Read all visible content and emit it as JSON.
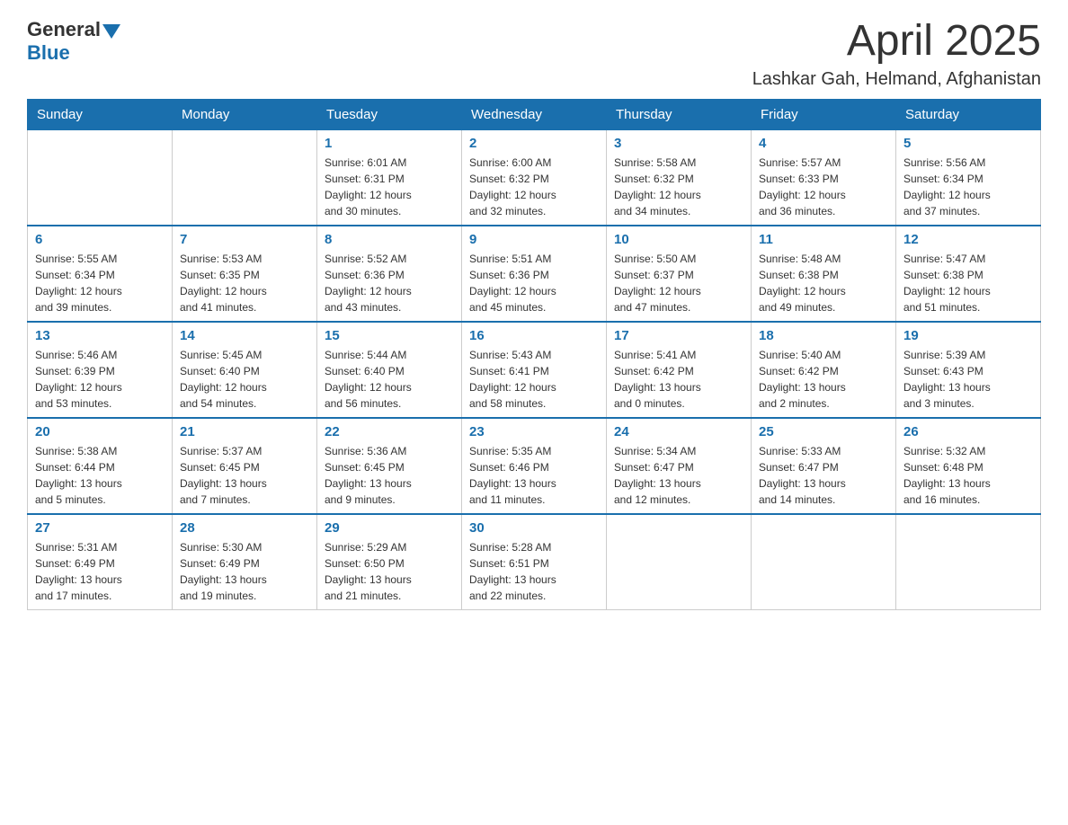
{
  "header": {
    "logo": {
      "general": "General",
      "blue": "Blue"
    },
    "title": "April 2025",
    "location": "Lashkar Gah, Helmand, Afghanistan"
  },
  "days_of_week": [
    "Sunday",
    "Monday",
    "Tuesday",
    "Wednesday",
    "Thursday",
    "Friday",
    "Saturday"
  ],
  "weeks": [
    [
      {
        "day": "",
        "info": ""
      },
      {
        "day": "",
        "info": ""
      },
      {
        "day": "1",
        "info": "Sunrise: 6:01 AM\nSunset: 6:31 PM\nDaylight: 12 hours\nand 30 minutes."
      },
      {
        "day": "2",
        "info": "Sunrise: 6:00 AM\nSunset: 6:32 PM\nDaylight: 12 hours\nand 32 minutes."
      },
      {
        "day": "3",
        "info": "Sunrise: 5:58 AM\nSunset: 6:32 PM\nDaylight: 12 hours\nand 34 minutes."
      },
      {
        "day": "4",
        "info": "Sunrise: 5:57 AM\nSunset: 6:33 PM\nDaylight: 12 hours\nand 36 minutes."
      },
      {
        "day": "5",
        "info": "Sunrise: 5:56 AM\nSunset: 6:34 PM\nDaylight: 12 hours\nand 37 minutes."
      }
    ],
    [
      {
        "day": "6",
        "info": "Sunrise: 5:55 AM\nSunset: 6:34 PM\nDaylight: 12 hours\nand 39 minutes."
      },
      {
        "day": "7",
        "info": "Sunrise: 5:53 AM\nSunset: 6:35 PM\nDaylight: 12 hours\nand 41 minutes."
      },
      {
        "day": "8",
        "info": "Sunrise: 5:52 AM\nSunset: 6:36 PM\nDaylight: 12 hours\nand 43 minutes."
      },
      {
        "day": "9",
        "info": "Sunrise: 5:51 AM\nSunset: 6:36 PM\nDaylight: 12 hours\nand 45 minutes."
      },
      {
        "day": "10",
        "info": "Sunrise: 5:50 AM\nSunset: 6:37 PM\nDaylight: 12 hours\nand 47 minutes."
      },
      {
        "day": "11",
        "info": "Sunrise: 5:48 AM\nSunset: 6:38 PM\nDaylight: 12 hours\nand 49 minutes."
      },
      {
        "day": "12",
        "info": "Sunrise: 5:47 AM\nSunset: 6:38 PM\nDaylight: 12 hours\nand 51 minutes."
      }
    ],
    [
      {
        "day": "13",
        "info": "Sunrise: 5:46 AM\nSunset: 6:39 PM\nDaylight: 12 hours\nand 53 minutes."
      },
      {
        "day": "14",
        "info": "Sunrise: 5:45 AM\nSunset: 6:40 PM\nDaylight: 12 hours\nand 54 minutes."
      },
      {
        "day": "15",
        "info": "Sunrise: 5:44 AM\nSunset: 6:40 PM\nDaylight: 12 hours\nand 56 minutes."
      },
      {
        "day": "16",
        "info": "Sunrise: 5:43 AM\nSunset: 6:41 PM\nDaylight: 12 hours\nand 58 minutes."
      },
      {
        "day": "17",
        "info": "Sunrise: 5:41 AM\nSunset: 6:42 PM\nDaylight: 13 hours\nand 0 minutes."
      },
      {
        "day": "18",
        "info": "Sunrise: 5:40 AM\nSunset: 6:42 PM\nDaylight: 13 hours\nand 2 minutes."
      },
      {
        "day": "19",
        "info": "Sunrise: 5:39 AM\nSunset: 6:43 PM\nDaylight: 13 hours\nand 3 minutes."
      }
    ],
    [
      {
        "day": "20",
        "info": "Sunrise: 5:38 AM\nSunset: 6:44 PM\nDaylight: 13 hours\nand 5 minutes."
      },
      {
        "day": "21",
        "info": "Sunrise: 5:37 AM\nSunset: 6:45 PM\nDaylight: 13 hours\nand 7 minutes."
      },
      {
        "day": "22",
        "info": "Sunrise: 5:36 AM\nSunset: 6:45 PM\nDaylight: 13 hours\nand 9 minutes."
      },
      {
        "day": "23",
        "info": "Sunrise: 5:35 AM\nSunset: 6:46 PM\nDaylight: 13 hours\nand 11 minutes."
      },
      {
        "day": "24",
        "info": "Sunrise: 5:34 AM\nSunset: 6:47 PM\nDaylight: 13 hours\nand 12 minutes."
      },
      {
        "day": "25",
        "info": "Sunrise: 5:33 AM\nSunset: 6:47 PM\nDaylight: 13 hours\nand 14 minutes."
      },
      {
        "day": "26",
        "info": "Sunrise: 5:32 AM\nSunset: 6:48 PM\nDaylight: 13 hours\nand 16 minutes."
      }
    ],
    [
      {
        "day": "27",
        "info": "Sunrise: 5:31 AM\nSunset: 6:49 PM\nDaylight: 13 hours\nand 17 minutes."
      },
      {
        "day": "28",
        "info": "Sunrise: 5:30 AM\nSunset: 6:49 PM\nDaylight: 13 hours\nand 19 minutes."
      },
      {
        "day": "29",
        "info": "Sunrise: 5:29 AM\nSunset: 6:50 PM\nDaylight: 13 hours\nand 21 minutes."
      },
      {
        "day": "30",
        "info": "Sunrise: 5:28 AM\nSunset: 6:51 PM\nDaylight: 13 hours\nand 22 minutes."
      },
      {
        "day": "",
        "info": ""
      },
      {
        "day": "",
        "info": ""
      },
      {
        "day": "",
        "info": ""
      }
    ]
  ]
}
